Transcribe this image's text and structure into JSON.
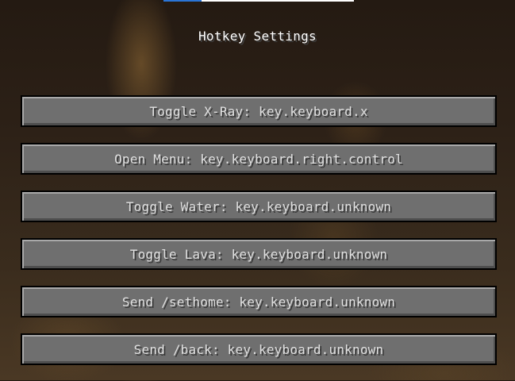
{
  "screen": {
    "title": "Hotkey Settings"
  },
  "top_bar": {
    "progress": 0.2,
    "fill_color": "#2a74d6"
  },
  "hotkeys": [
    {
      "label": "Toggle X-Ray: key.keyboard.x"
    },
    {
      "label": "Open Menu: key.keyboard.right.control"
    },
    {
      "label": "Toggle Water: key.keyboard.unknown"
    },
    {
      "label": "Toggle Lava: key.keyboard.unknown"
    },
    {
      "label": "Send /sethome: key.keyboard.unknown"
    },
    {
      "label": "Send /back: key.keyboard.unknown"
    }
  ]
}
